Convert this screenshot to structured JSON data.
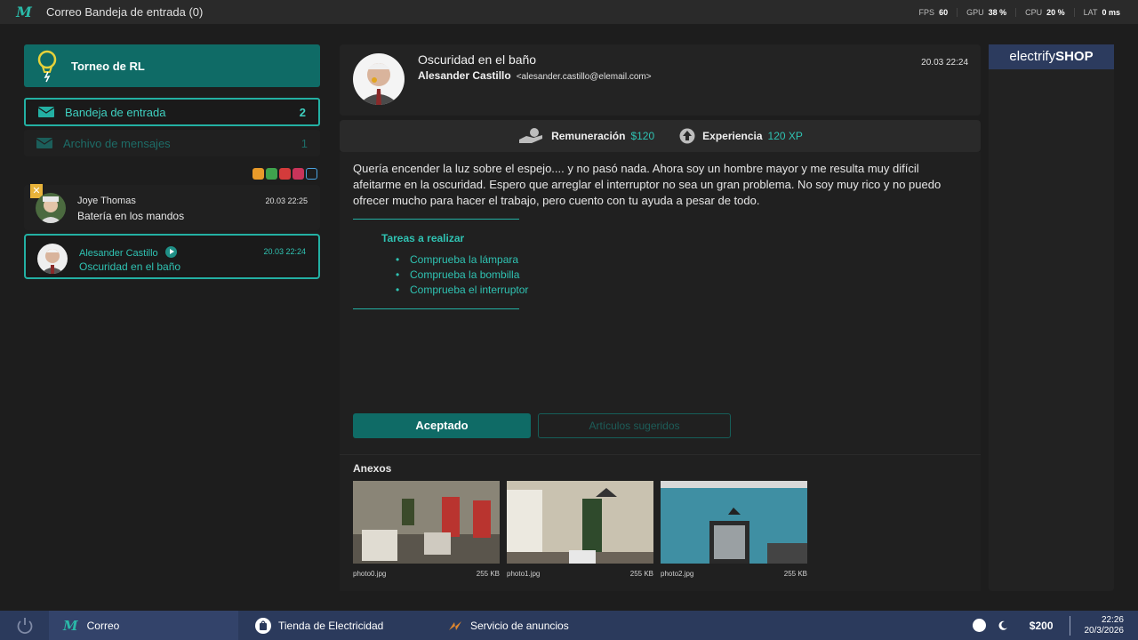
{
  "window": {
    "app_icon": "m-logo-icon",
    "title": "Correo  Bandeja de entrada (0)"
  },
  "stats": [
    {
      "label": "FPS",
      "value": "60"
    },
    {
      "label": "GPU",
      "value": "38 %"
    },
    {
      "label": "CPU",
      "value": "20 %"
    },
    {
      "label": "LAT",
      "value": "0 ms"
    }
  ],
  "sidebar": {
    "tournament_label": "Torneo de RL",
    "folders": [
      {
        "label": "Bandeja de entrada",
        "count": "2"
      },
      {
        "label": "Archivo de mensajes",
        "count": "1"
      }
    ],
    "mails": [
      {
        "sender": "Joye Thomas",
        "subject": "Batería en los mandos",
        "date": "20.03 22:25",
        "badge": "✕"
      },
      {
        "sender": "Alesander Castillo",
        "subject": "Oscuridad en el baño",
        "date": "20.03 22:24"
      }
    ]
  },
  "message": {
    "subject": "Oscuridad en el baño",
    "from_name": "Alesander Castillo",
    "from_email": "<alesander.castillo@elemail.com>",
    "date": "20.03 22:24",
    "reward_label": "Remuneración",
    "reward_value": "$120",
    "xp_label": "Experiencia",
    "xp_value": "120 XP",
    "body": "Quería encender la luz sobre el espejo.... y no pasó nada. Ahora soy un hombre mayor y me resulta muy difícil afeitarme en la oscuridad. Espero que arreglar el interruptor no sea un gran problema. No soy muy rico y no puedo ofrecer mucho para hacer el trabajo, pero cuento con tu ayuda a pesar de todo.",
    "tasks_title": "Tareas a realizar",
    "tasks": [
      "Comprueba la lámpara",
      "Comprueba la bombilla",
      "Comprueba el interruptor"
    ],
    "accept_label": "Aceptado",
    "suggest_label": "Artículos sugeridos",
    "attachments_title": "Anexos",
    "attachments": [
      {
        "name": "photo0.jpg",
        "size": "255 KB"
      },
      {
        "name": "photo1.jpg",
        "size": "255 KB"
      },
      {
        "name": "photo2.jpg",
        "size": "255 KB"
      }
    ]
  },
  "ad": {
    "brand_light": "electrify",
    "brand_bold": "SHOP"
  },
  "taskbar": {
    "tasks": [
      {
        "label": "Correo",
        "icon": "m-logo-icon"
      },
      {
        "label": "Tienda de Electricidad",
        "icon": "shop-bag-icon"
      },
      {
        "label": "Servicio de anuncios",
        "icon": "ads-icon"
      }
    ],
    "money": "$200",
    "time": "22:26",
    "date": "20/3/2026"
  },
  "colors": {
    "accent": "#2fc2b2",
    "accent_dark": "#0f6b66",
    "taskbar": "#2b3a5c"
  }
}
